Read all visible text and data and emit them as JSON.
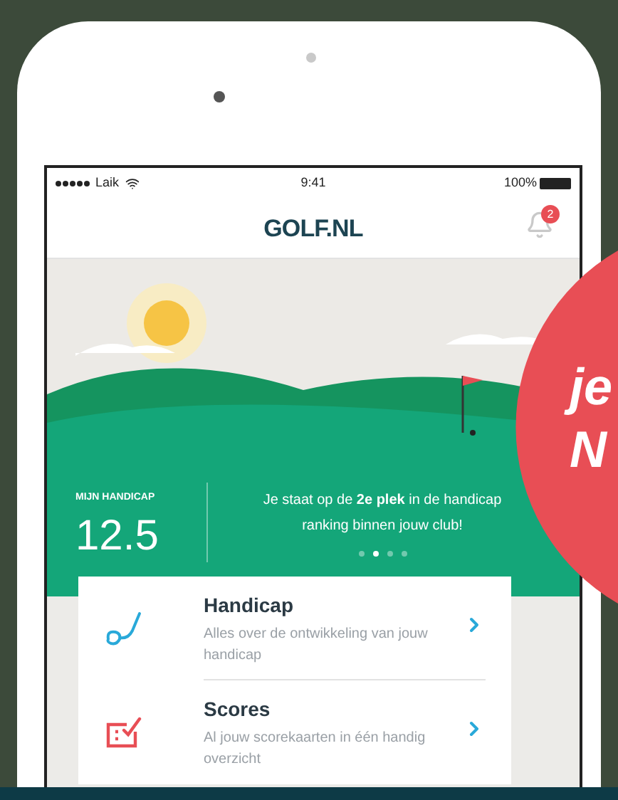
{
  "status_bar": {
    "carrier": "Laik",
    "time": "9:41",
    "battery": "100%"
  },
  "header": {
    "logo": "GOLF.NL",
    "notification_count": "2"
  },
  "handicap": {
    "label": "MIJN HANDICAP",
    "value": "12.5"
  },
  "carousel": {
    "message": "Je staat op de **2e plek** in de handicap ranking binnen jouw club!",
    "dots": [
      {
        "selected": false
      },
      {
        "selected": true
      },
      {
        "selected": false
      },
      {
        "selected": false
      }
    ]
  },
  "menu": [
    {
      "kind": "handicap",
      "title": "Handicap",
      "subtitle": "Alles over de ontwikkeling van jouw handicap"
    },
    {
      "kind": "scores",
      "title": "Scores",
      "subtitle": "Al jouw scorekaarten in één handig overzicht"
    }
  ],
  "promo": {
    "lines": [
      "je",
      "N"
    ]
  }
}
